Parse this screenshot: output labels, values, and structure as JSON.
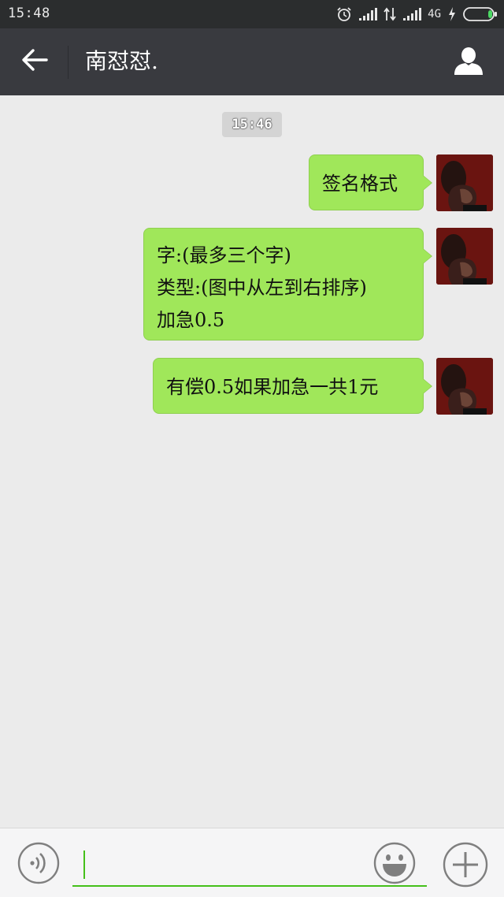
{
  "status_bar": {
    "time": "15:48",
    "network_label": "4G",
    "icons": [
      "alarm-icon",
      "signal-icon",
      "data-arrows-icon",
      "signal-icon",
      "charging-icon",
      "battery-icon"
    ]
  },
  "header": {
    "title": "南怼怼.",
    "back_icon": "arrow-left-icon",
    "contact_icon": "person-icon",
    "background": "#393a3f"
  },
  "chat": {
    "timestamp": "15:46",
    "bubble_color": "#a0e75a",
    "messages": [
      {
        "sender": "self",
        "lines": [
          "签名格式"
        ]
      },
      {
        "sender": "self",
        "lines": [
          "字:(最多三个字)",
          "类型:(图中从左到右排序)",
          "加急0.5"
        ]
      },
      {
        "sender": "self",
        "lines": [
          "有偿0.5如果加急一共1元"
        ]
      }
    ]
  },
  "input_bar": {
    "voice_icon": "voice-icon",
    "emoji_icon": "emoji-icon",
    "more_icon": "plus-icon",
    "accent": "#45c01a",
    "text_value": ""
  }
}
